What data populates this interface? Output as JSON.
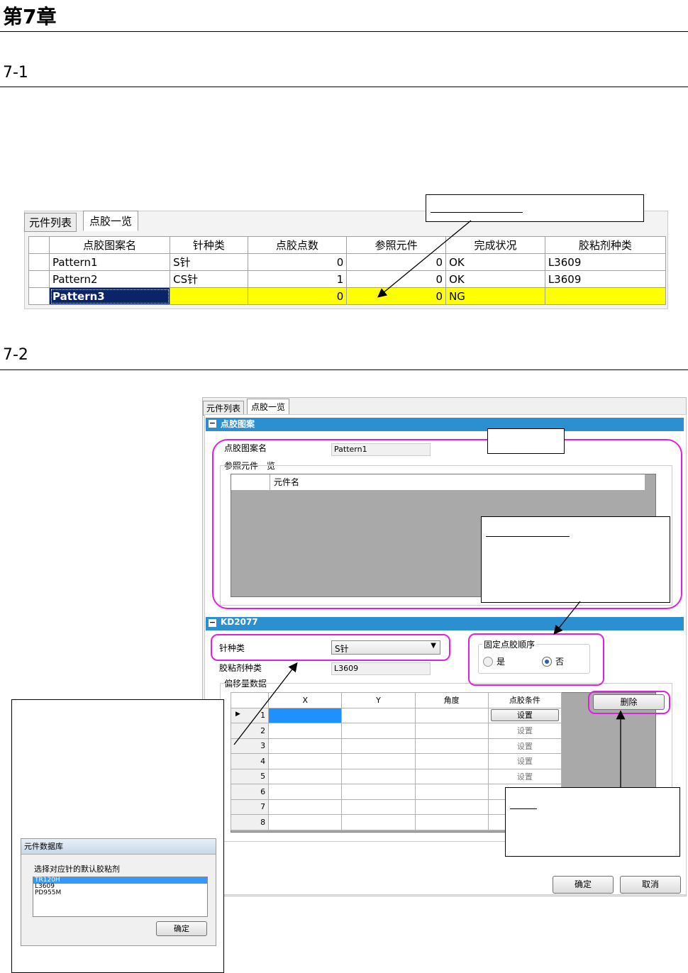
{
  "chapter": {
    "title": "第7章"
  },
  "section1": {
    "heading": "7-1",
    "tabs": [
      "元件列表",
      "点胶一览"
    ],
    "columns": [
      "点胶图案名",
      "针种类",
      "点胶点数",
      "参照元件",
      "完成状况",
      "胶粘剂种类"
    ],
    "rows": [
      [
        "Pattern1",
        "S针",
        "0",
        "0",
        "OK",
        "L3609"
      ],
      [
        "Pattern2",
        "CS针",
        "1",
        "0",
        "OK",
        "L3609"
      ],
      [
        "Pattern3",
        "",
        "0",
        "0",
        "NG",
        ""
      ]
    ]
  },
  "section2": {
    "heading": "7-2",
    "tabs": [
      "元件列表",
      "点胶一览"
    ],
    "panel1": {
      "title": "点胶图案",
      "pattern_name_label": "点胶图案名",
      "pattern_name_value": "Pattern1",
      "ref_list_label": "参照元件一览",
      "ref_list_column": "元件名"
    },
    "panel2": {
      "title": "KD2077",
      "needle_label": "针种类",
      "needle_value": "S针",
      "adhesive_label": "胶粘剂种类",
      "adhesive_value": "L3609",
      "fixed_order_label": "固定点胶顺序",
      "radio_yes": "是",
      "radio_no": "否",
      "offset_label": "偏移量数据",
      "offset_columns": [
        "X",
        "Y",
        "角度",
        "点胶条件"
      ],
      "offset_rows": [
        "1",
        "2",
        "3",
        "4",
        "5",
        "6",
        "7",
        "8"
      ],
      "set_label": "设置",
      "delete_label": "删除"
    },
    "ok_label": "确定",
    "cancel_label": "取消",
    "dialog": {
      "title": "元件数据库",
      "prompt": "选择对应针的默认胶粘剂",
      "options": [
        "TR120H",
        "L3609",
        "PD955M"
      ],
      "selected": "TR120H",
      "ok_label": "确定"
    }
  },
  "colors": {
    "highlight_row": "#ffff00",
    "callout_border": "#e020e0",
    "panel_bar": "#2c8fd0",
    "selected_cell": "#1e90ff"
  }
}
